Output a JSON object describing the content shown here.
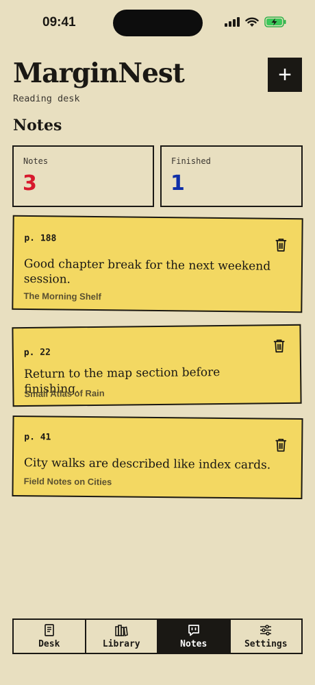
{
  "status_bar": {
    "time": "09:41",
    "icons": [
      "signal-icon",
      "wifi-icon",
      "battery-charging-icon"
    ]
  },
  "header": {
    "title": "MarginNest",
    "subtitle": "Reading desk",
    "add_label": "+"
  },
  "section": {
    "title": "Notes"
  },
  "stats": [
    {
      "label": "Notes",
      "value": "3",
      "color": "#d7192d"
    },
    {
      "label": "Finished",
      "value": "1",
      "color": "#0f2fa8"
    }
  ],
  "notes": [
    {
      "page": "p. 188",
      "text": "Good chapter break for the next weekend session.",
      "book": "The Morning Shelf"
    },
    {
      "page": "p. 22",
      "text": "Return to the map section before finishing.",
      "book": "Small Atlas of Rain"
    },
    {
      "page": "p. 41",
      "text": "City walks are described like index cards.",
      "book": "Field Notes on Cities"
    }
  ],
  "tabs": [
    {
      "label": "Desk",
      "icon": "book-icon",
      "active": false
    },
    {
      "label": "Library",
      "icon": "library-icon",
      "active": false
    },
    {
      "label": "Notes",
      "icon": "chat-bubble-icon",
      "active": true
    },
    {
      "label": "Settings",
      "icon": "sliders-icon",
      "active": false
    }
  ],
  "colors": {
    "background": "#e8dfc0",
    "note": "#f3d862",
    "ink": "#1a1814"
  }
}
